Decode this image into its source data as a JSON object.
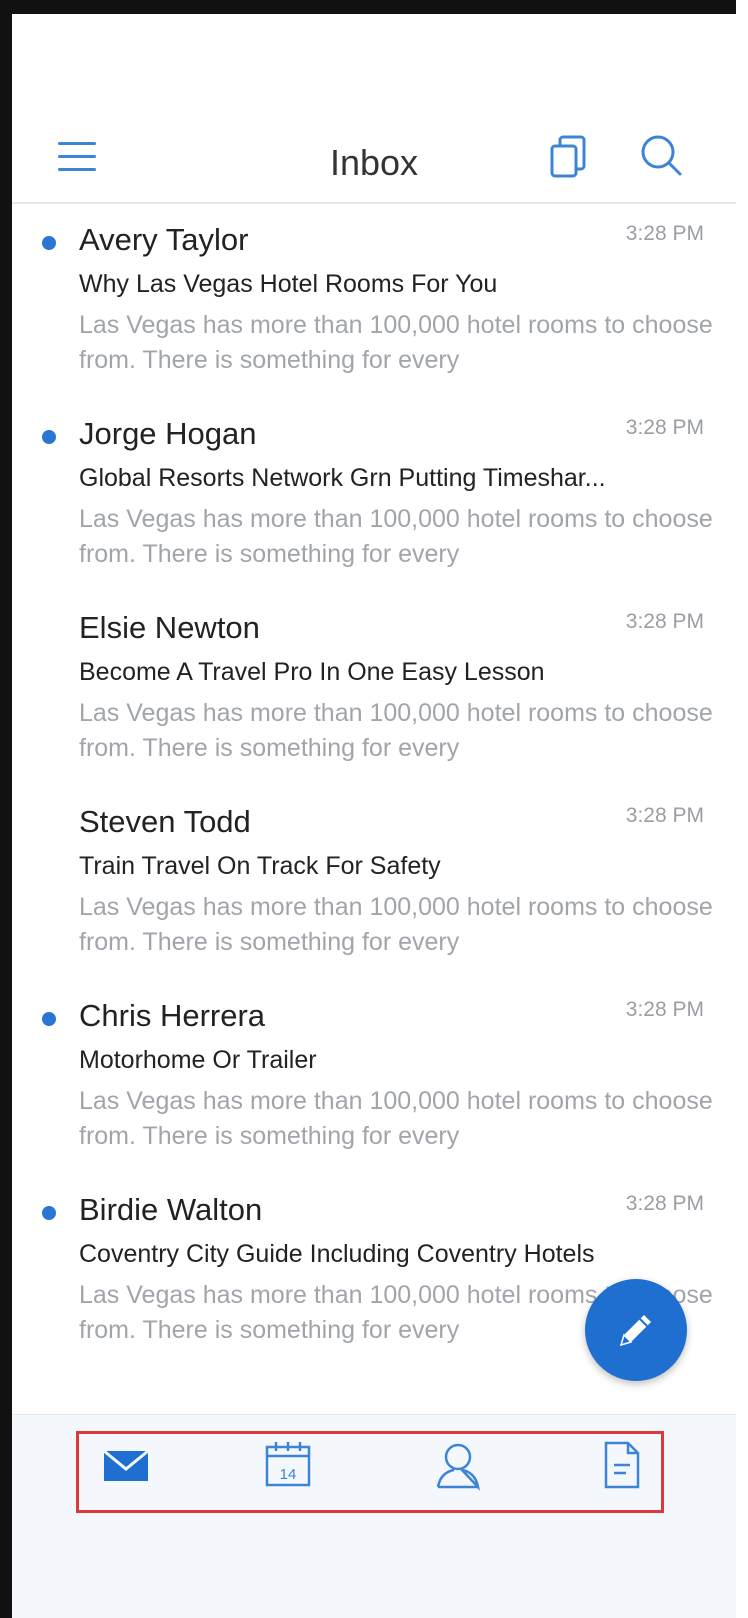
{
  "header": {
    "title": "Inbox"
  },
  "icons": {
    "menu": "hamburger-icon",
    "cards": "cards-icon",
    "search": "search-icon",
    "compose": "pencil-icon"
  },
  "messages": [
    {
      "sender": "Avery Taylor",
      "time": "3:28 PM",
      "subject": "Why Las Vegas Hotel Rooms For You",
      "preview": "Las Vegas has more than 100,000 hotel rooms to choose from. There is something for every",
      "unread": true
    },
    {
      "sender": "Jorge Hogan",
      "time": "3:28 PM",
      "subject": "Global Resorts Network Grn Putting Timeshar...",
      "preview": "Las Vegas has more than 100,000 hotel rooms to choose from. There is something for every",
      "unread": true
    },
    {
      "sender": "Elsie Newton",
      "time": "3:28 PM",
      "subject": "Become A Travel Pro In One Easy Lesson",
      "preview": "Las Vegas has more than 100,000 hotel rooms to choose from. There is something for every",
      "unread": false
    },
    {
      "sender": "Steven Todd",
      "time": "3:28 PM",
      "subject": "Train Travel On Track For Safety",
      "preview": "Las Vegas has more than 100,000 hotel rooms to choose from. There is something for every",
      "unread": false
    },
    {
      "sender": "Chris Herrera",
      "time": "3:28 PM",
      "subject": "Motorhome Or Trailer",
      "preview": "Las Vegas has more than 100,000 hotel rooms to choose from. There is something for every",
      "unread": true
    },
    {
      "sender": "Birdie Walton",
      "time": "3:28 PM",
      "subject": "Coventry City Guide Including Coventry Hotels",
      "preview": "Las Vegas has more than 100,000 hotel rooms to choose from. There is something for every",
      "unread": true
    }
  ],
  "tabbar": {
    "calendar_day": "14",
    "tabs": [
      "mail-icon",
      "calendar-icon",
      "contacts-icon",
      "files-icon"
    ]
  },
  "colors": {
    "accent": "#2a76d2",
    "highlight": "#d93a3a"
  }
}
